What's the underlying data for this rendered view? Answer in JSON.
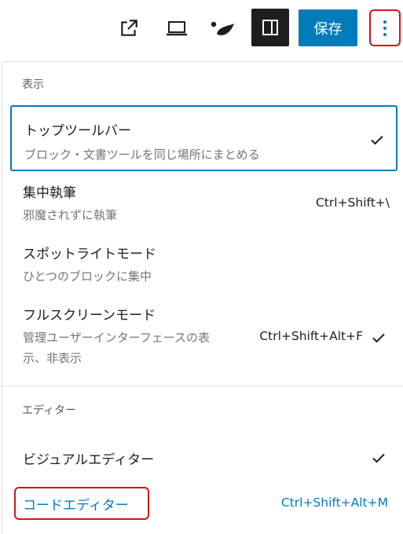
{
  "toolbar": {
    "icons": [
      "external-link-icon",
      "laptop-icon",
      "site-logo-icon",
      "sidebar-panel-icon",
      "more-vertical-icon"
    ],
    "save_label": "保存"
  },
  "menu": {
    "view_group_label": "表示",
    "view_items": [
      {
        "title": "トップツールバー",
        "description": "ブロック・文書ツールを同じ場所にまとめる",
        "checked": true,
        "focused": true
      },
      {
        "title": "集中執筆",
        "description": "邪魔されずに執筆",
        "shortcut": "Ctrl+Shift+\\",
        "checked": false
      },
      {
        "title": "スポットライトモード",
        "description": "ひとつのブロックに集中",
        "checked": false
      },
      {
        "title": "フルスクリーンモード",
        "description": "管理ユーザーインターフェースの表示、非表示",
        "shortcut": "Ctrl+Shift+Alt+F",
        "checked": true
      }
    ],
    "editor_group_label": "エディター",
    "editor_items": [
      {
        "title": "ビジュアルエディター",
        "checked": true
      },
      {
        "title": "コードエディター",
        "shortcut": "Ctrl+Shift+Alt+M",
        "highlighted": true
      }
    ]
  },
  "colors": {
    "accent": "#007cba",
    "highlight": "#cc1818",
    "text": "#1e1e1e",
    "muted": "#757575"
  }
}
